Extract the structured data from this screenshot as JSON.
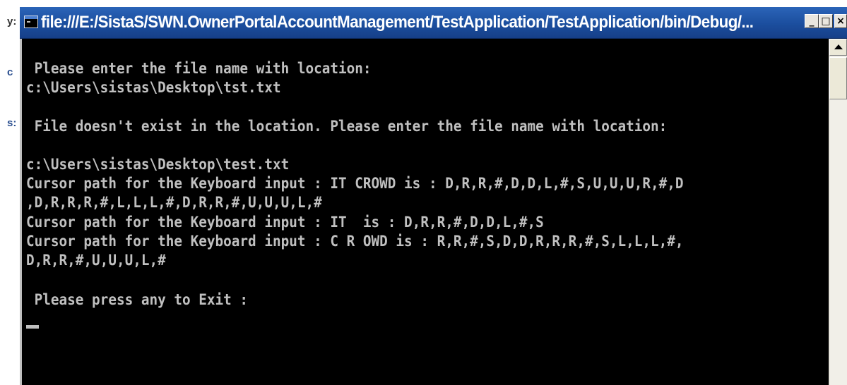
{
  "background": {
    "chars": [
      "y:",
      "c",
      "s:"
    ]
  },
  "window": {
    "title": "file:///E:/SistaS/SWN.OwnerPortalAccountManagement/TestApplication/TestApplication/bin/Debug/...",
    "controls": {
      "minimize": "_",
      "maximize": "□",
      "close": "×"
    }
  },
  "console": {
    "lines": [
      " Please enter the file name with location:",
      "c:\\Users\\sistas\\Desktop\\tst.txt",
      "",
      " File doesn't exist in the location. Please enter the file name with location:",
      "",
      "c:\\Users\\sistas\\Desktop\\test.txt",
      "Cursor path for the Keyboard input : IT CROWD is : D,R,R,#,D,D,L,#,S,U,U,U,R,#,D",
      ",D,R,R,R,#,L,L,L,#,D,R,R,#,U,U,U,L,#",
      "Cursor path for the Keyboard input : IT  is : D,R,R,#,D,D,L,#,S",
      "Cursor path for the Keyboard input : C R OWD is : R,R,#,S,D,D,R,R,R,#,S,L,L,L,#,",
      "D,R,R,#,U,U,U,L,#",
      "",
      " Please press any to Exit :"
    ]
  },
  "colors": {
    "titlebar": "#1b4e9e",
    "console_bg": "#000000",
    "console_text": "#c0c0c0"
  }
}
